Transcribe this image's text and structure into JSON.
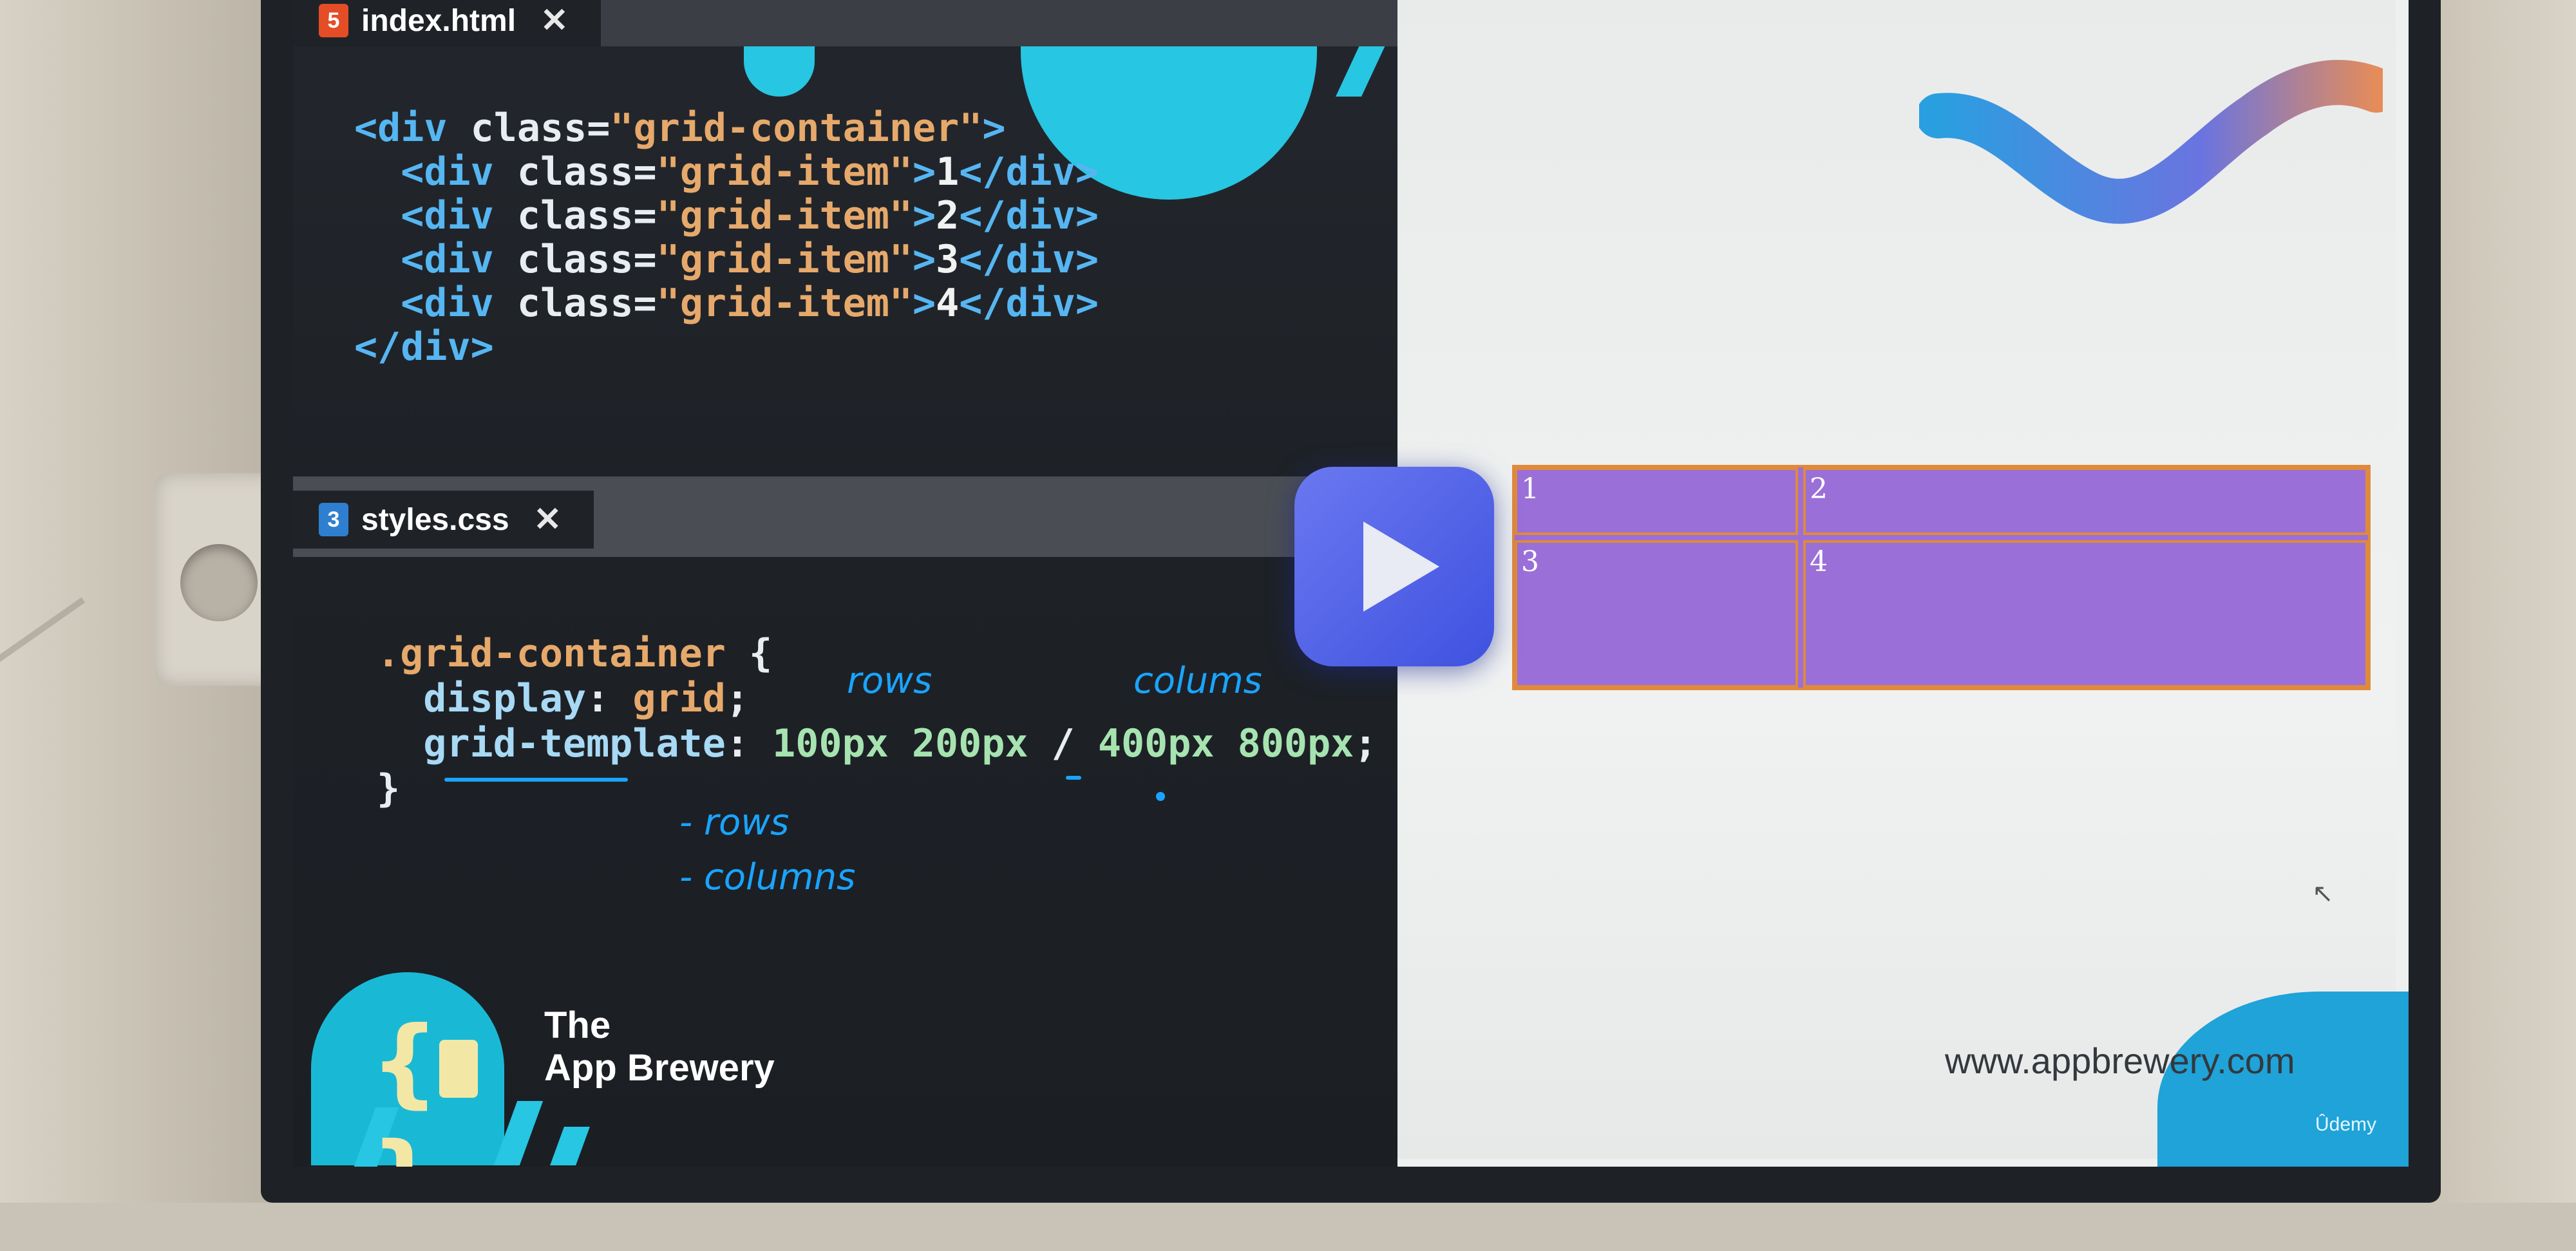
{
  "editor": {
    "html_tab": {
      "icon": "html5-icon",
      "badge": "5",
      "label": "index.html",
      "close": "✕"
    },
    "css_tab": {
      "icon": "css3-icon",
      "badge": "3",
      "label": "styles.css",
      "close": "✕"
    },
    "html_code": [
      {
        "parts": [
          [
            "c-tag",
            "<div "
          ],
          [
            "c-attr",
            "class="
          ],
          [
            "c-str",
            "\"grid-container\""
          ],
          [
            "c-tag",
            ">"
          ]
        ]
      },
      {
        "parts": [
          [
            "c-tag",
            "  <div "
          ],
          [
            "c-attr",
            "class="
          ],
          [
            "c-str",
            "\"grid-item\""
          ],
          [
            "c-tag",
            ">"
          ],
          [
            "c-txt",
            "1"
          ],
          [
            "c-tag",
            "</div>"
          ]
        ]
      },
      {
        "parts": [
          [
            "c-tag",
            "  <div "
          ],
          [
            "c-attr",
            "class="
          ],
          [
            "c-str",
            "\"grid-item\""
          ],
          [
            "c-tag",
            ">"
          ],
          [
            "c-txt",
            "2"
          ],
          [
            "c-tag",
            "</div>"
          ]
        ]
      },
      {
        "parts": [
          [
            "c-tag",
            "  <div "
          ],
          [
            "c-attr",
            "class="
          ],
          [
            "c-str",
            "\"grid-item\""
          ],
          [
            "c-tag",
            ">"
          ],
          [
            "c-txt",
            "3"
          ],
          [
            "c-tag",
            "</div>"
          ]
        ]
      },
      {
        "parts": [
          [
            "c-tag",
            "  <div "
          ],
          [
            "c-attr",
            "class="
          ],
          [
            "c-str",
            "\"grid-item\""
          ],
          [
            "c-tag",
            ">"
          ],
          [
            "c-txt",
            "4"
          ],
          [
            "c-tag",
            "</div>"
          ]
        ]
      },
      {
        "parts": [
          [
            "c-tag",
            "</div>"
          ]
        ]
      }
    ],
    "css_code": [
      {
        "parts": [
          [
            "c-sel",
            ".grid-container"
          ],
          [
            "c-pun",
            " {"
          ]
        ]
      },
      {
        "parts": [
          [
            "c-prop",
            "  display"
          ],
          [
            "c-pun",
            ": "
          ],
          [
            "c-val",
            "grid"
          ],
          [
            "c-pun",
            ";"
          ]
        ]
      },
      {
        "parts": [
          [
            "c-prop",
            "  grid-template"
          ],
          [
            "c-pun",
            ": "
          ],
          [
            "c-num",
            "100px 200px "
          ],
          [
            "c-pun",
            "/ "
          ],
          [
            "c-num",
            "400px 800px"
          ],
          [
            "c-pun",
            ";"
          ]
        ]
      },
      {
        "parts": [
          [
            "c-pun",
            "}"
          ]
        ]
      }
    ],
    "annotations": {
      "rows": "rows",
      "columns": "colums",
      "list_rows": "- rows",
      "list_columns": "- columns"
    },
    "brand": {
      "line1": "The",
      "line2": "App Brewery"
    }
  },
  "browser": {
    "grid_items": [
      "1",
      "2",
      "3",
      "4"
    ],
    "url": "www.appbrewery.com",
    "watermark": "Ûdemy"
  },
  "colors": {
    "accent_cyan": "#27c6e2",
    "grid_purple": "#9b6fd8",
    "grid_border": "#e08a3c",
    "play_button": "#4f61e6"
  }
}
